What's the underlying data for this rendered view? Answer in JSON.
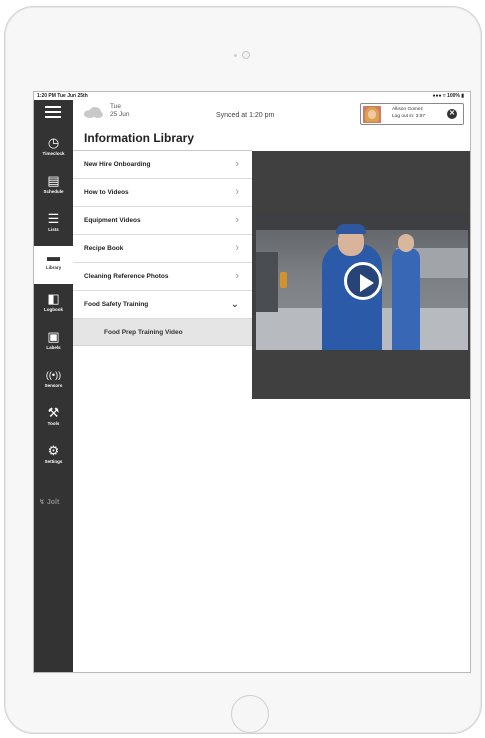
{
  "status_bar": {
    "time_date": "1:20 PM Tue Jun 25th",
    "indicators": "100%"
  },
  "header": {
    "weather_icon": "cloud-icon",
    "day": "Tue",
    "date": "25 Jun",
    "sync_status": "Synced at 1:20 pm",
    "user": {
      "name": "Allison Gomez",
      "logout": "Log out in: 3:57"
    }
  },
  "sidebar": {
    "menu_icon": "hamburger-menu-icon",
    "items": [
      {
        "label": "Timeclock",
        "icon": "clock-icon",
        "active": false
      },
      {
        "label": "Schedule",
        "icon": "calendar-icon",
        "active": false
      },
      {
        "label": "Lists",
        "icon": "checklist-icon",
        "active": false
      },
      {
        "label": "Library",
        "icon": "folder-icon",
        "active": true
      },
      {
        "label": "Logbook",
        "icon": "book-icon",
        "active": false
      },
      {
        "label": "Labels",
        "icon": "label-printer-icon",
        "active": false
      },
      {
        "label": "Sensors",
        "icon": "sensor-signal-icon",
        "active": false
      },
      {
        "label": "Tools",
        "icon": "wrench-icon",
        "active": false
      },
      {
        "label": "Settings",
        "icon": "gear-icon",
        "active": false
      }
    ],
    "logo": "Jolt"
  },
  "main": {
    "title": "Information Library",
    "items": [
      {
        "label": "New Hire Onboarding",
        "expanded": false
      },
      {
        "label": "How to Videos",
        "expanded": false
      },
      {
        "label": "Equipment Videos",
        "expanded": false
      },
      {
        "label": "Recipe Book",
        "expanded": false
      },
      {
        "label": "Cleaning Reference Photos",
        "expanded": false
      },
      {
        "label": "Food Safety Training",
        "expanded": true
      }
    ],
    "sub_items": [
      {
        "label": "Food Prep Training Video",
        "selected": true
      }
    ]
  },
  "video": {
    "play_icon": "play-icon"
  },
  "colors": {
    "sidebar_bg": "#333333",
    "video_panel_bg": "#404040",
    "selected_sub_item_bg": "#e5e5e5"
  }
}
